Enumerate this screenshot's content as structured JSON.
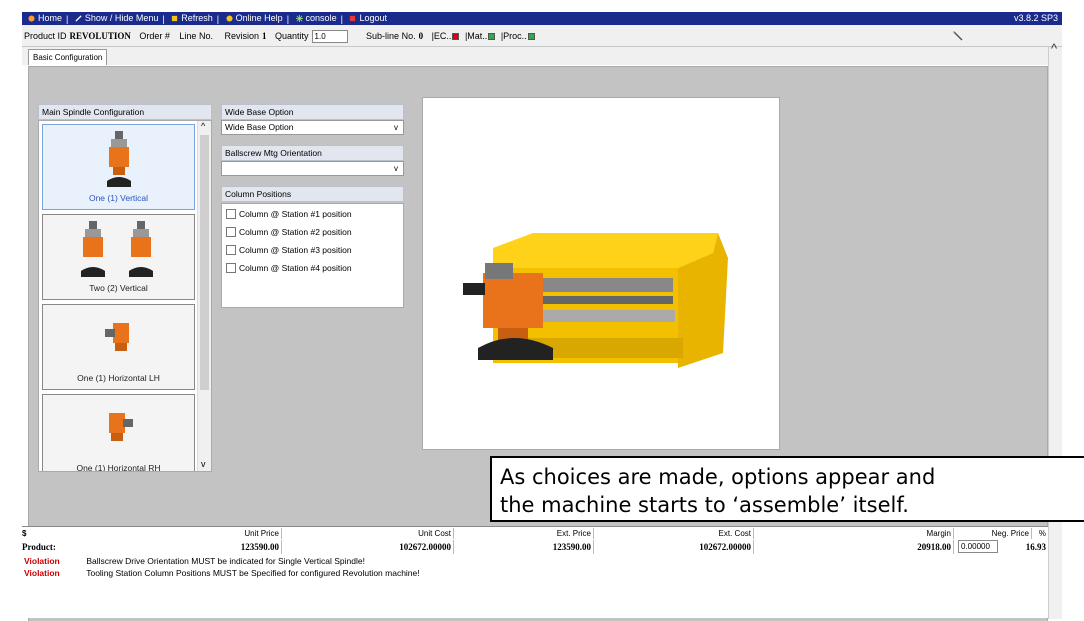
{
  "nav": {
    "items": [
      {
        "label": "Home",
        "icon": "home-icon",
        "color": "#ff9a2e"
      },
      {
        "label": "Show / Hide Menu",
        "icon": "menu-toggle-icon",
        "color": "#ffffff"
      },
      {
        "label": "Refresh",
        "icon": "refresh-icon",
        "color": "#f0c419"
      },
      {
        "label": "Online Help",
        "icon": "help-icon",
        "color": "#f0c419"
      },
      {
        "label": "console",
        "icon": "console-icon",
        "color": "#9adf6a"
      },
      {
        "label": "Logout",
        "icon": "logout-icon",
        "color": "#e53935"
      }
    ],
    "version": "v3.8.2 SP3"
  },
  "info": {
    "product_id_label": "Product ID",
    "product_id_value": "REVOLUTION",
    "order_label": "Order #",
    "line_label": "Line No.",
    "revision_label": "Revision",
    "revision_value": "1",
    "quantity_label": "Quantity",
    "quantity_value": "1.0",
    "subline_label": "Sub-line No.",
    "subline_value": "0",
    "ec_label": "|EC..",
    "mat_label": "|Mat..",
    "proc_label": "|Proc..",
    "ec_color": "#d0021b",
    "mat_color": "#2eaa4a",
    "proc_color": "#2eaa4a"
  },
  "tabs": [
    {
      "label": "Basic Configuration"
    }
  ],
  "spindle": {
    "header": "Main Spindle Configuration",
    "items": [
      {
        "label": "One (1) Vertical",
        "selected": true
      },
      {
        "label": "Two (2) Vertical",
        "selected": false
      },
      {
        "label": "One (1) Horizontal LH",
        "selected": false
      },
      {
        "label": "One (1) Horizontal RH",
        "selected": false
      }
    ]
  },
  "options": {
    "wide_base_header": "Wide Base Option",
    "wide_base_value": "Wide Base Option",
    "ballscrew_header": "Ballscrew Mtg Orientation",
    "ballscrew_value": "",
    "columns_header": "Column Positions",
    "columns": [
      "Column @ Station #1 position",
      "Column @ Station #2 position",
      "Column @ Station #3 position",
      "Column @ Station #4 position"
    ]
  },
  "callout": {
    "line1": "As choices are made, options appear and",
    "line2": "the machine starts to ‘assemble’ itself."
  },
  "pricing": {
    "currency": "$",
    "row_label": "Product:",
    "headers": [
      "Unit Price",
      "Unit Cost",
      "Ext. Price",
      "Ext. Cost",
      "Margin",
      "Neg. Price",
      "%"
    ],
    "values": [
      "123590.00",
      "102672.00000",
      "123590.00",
      "102672.00000",
      "20918.00"
    ],
    "neg_price": "0.00000",
    "percent": "16.93"
  },
  "violations": [
    {
      "tag": "Violation",
      "text": "Ballscrew Drive Orientation MUST be indicated for Single Vertical Spindle!"
    },
    {
      "tag": "Violation",
      "text": "Tooling Station Column Positions MUST be Specified for configured Revolution machine!"
    }
  ]
}
